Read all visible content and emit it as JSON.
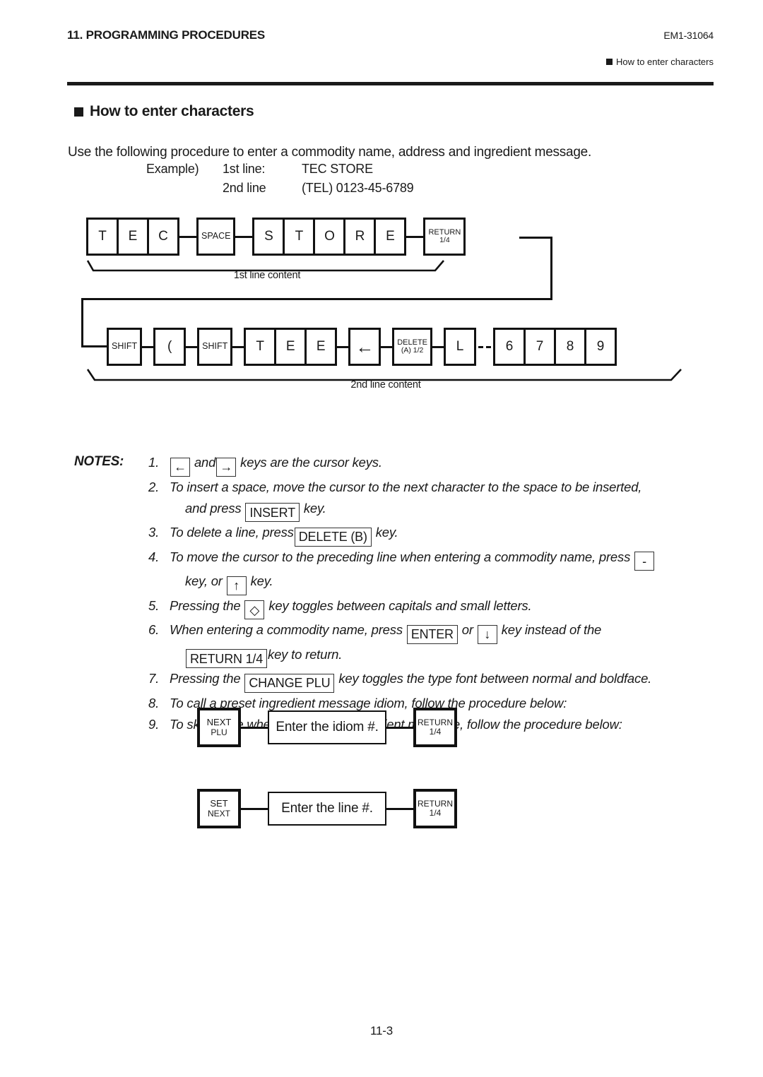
{
  "header": {
    "chapter": "11. PROGRAMMING PROCEDURES",
    "doc_code": "EM1-31064",
    "section": "How to enter characters"
  },
  "title": "How to enter characters",
  "intro": "Use the following procedure to enter a commodity name, address and ingredient message.",
  "example": {
    "label": "Example)",
    "rows": [
      {
        "line": "1st line:",
        "value": "TEC STORE"
      },
      {
        "line": "2nd line",
        "value": "(TEL) 0123-45-6789"
      }
    ]
  },
  "diagram1": {
    "caption": "1st  line content",
    "groups": [
      {
        "keys": [
          {
            "t": "T"
          },
          {
            "t": "E"
          },
          {
            "t": "C"
          }
        ]
      },
      {
        "keys": [
          {
            "t": "SPACE",
            "size": "small"
          }
        ]
      },
      {
        "keys": [
          {
            "t": "S"
          },
          {
            "t": "T"
          },
          {
            "t": "O"
          },
          {
            "t": "R"
          },
          {
            "t": "E"
          }
        ]
      }
    ],
    "return_key": {
      "t": "RETURN",
      "t2": "1/4"
    }
  },
  "diagram2": {
    "caption": "2nd line content",
    "groups": [
      {
        "keys": [
          {
            "t": "SHIFT",
            "size": "small"
          }
        ]
      },
      {
        "keys": [
          {
            "t": "("
          }
        ]
      },
      {
        "keys": [
          {
            "t": "SHIFT",
            "size": "small"
          }
        ]
      },
      {
        "keys": [
          {
            "t": "T"
          },
          {
            "t": "E"
          },
          {
            "t": "E"
          }
        ]
      },
      {
        "keys": [
          {
            "t": "←",
            "size": "arrow"
          }
        ]
      },
      {
        "keys": [
          {
            "t": "DELETE",
            "t2": "(A) 1/2",
            "size": "tiny"
          }
        ]
      },
      {
        "keys": [
          {
            "t": "L"
          }
        ]
      },
      {
        "keys": [
          {
            "t": "6"
          },
          {
            "t": "7"
          },
          {
            "t": "8"
          },
          {
            "t": "9"
          }
        ]
      }
    ]
  },
  "notes": {
    "label": "NOTES:",
    "items": [
      {
        "num": "1.",
        "lines": [
          [
            {
              "type": "key",
              "text": "←"
            },
            {
              "type": "text",
              "text": " and"
            },
            {
              "type": "key",
              "text": "→"
            },
            {
              "type": "text",
              "text": " keys are the cursor keys."
            }
          ]
        ]
      },
      {
        "num": "2.",
        "lines": [
          [
            {
              "type": "text",
              "text": "To insert a space, move the cursor to the next character to the space to be inserted,"
            }
          ],
          [
            {
              "type": "text",
              "text": "and press "
            },
            {
              "type": "key",
              "text": "INSERT"
            },
            {
              "type": "text",
              "text": " key."
            }
          ]
        ]
      },
      {
        "num": "3.",
        "lines": [
          [
            {
              "type": "text",
              "text": "To delete a line, press"
            },
            {
              "type": "key",
              "text": "DELETE (B)"
            },
            {
              "type": "text",
              "text": " key."
            }
          ]
        ]
      },
      {
        "num": "4.",
        "lines": [
          [
            {
              "type": "text",
              "text": "To move the cursor to the preceding line when entering a commodity name, press "
            },
            {
              "type": "key",
              "text": "-"
            }
          ],
          [
            {
              "type": "text",
              "text": "key, or "
            },
            {
              "type": "key",
              "text": "↑"
            },
            {
              "type": "text",
              "text": " key."
            }
          ]
        ]
      },
      {
        "num": "5.",
        "lines": [
          [
            {
              "type": "text",
              "text": "Pressing the "
            },
            {
              "type": "key",
              "text": "◇"
            },
            {
              "type": "text",
              "text": " key toggles between capitals and small letters."
            }
          ]
        ]
      },
      {
        "num": "6.",
        "lines": [
          [
            {
              "type": "text",
              "text": "When entering a commodity name, press "
            },
            {
              "type": "key",
              "text": "ENTER"
            },
            {
              "type": "text",
              "text": " or "
            },
            {
              "type": "key",
              "text": "↓"
            },
            {
              "type": "text",
              "text": " key instead of the"
            }
          ],
          [
            {
              "type": "key",
              "text": "RETURN 1/4"
            },
            {
              "type": "text",
              "text": "key to return."
            }
          ]
        ]
      },
      {
        "num": "7.",
        "lines": [
          [
            {
              "type": "text",
              "text": "Pressing the "
            },
            {
              "type": "key",
              "text": "CHANGE PLU"
            },
            {
              "type": "text",
              "text": " key toggles the type font between normal and boldface."
            }
          ]
        ]
      },
      {
        "num": "8.",
        "lines": [
          [
            {
              "type": "text",
              "text": "To call a preset ingredient message idiom, follow the procedure below:"
            }
          ]
        ]
      },
      {
        "num": "9.",
        "lines": [
          [
            {
              "type": "text",
              "text": "To skip a line when entering an ingredient message, follow the procedure below:"
            }
          ]
        ]
      }
    ]
  },
  "flows": [
    {
      "start": {
        "t": "NEXT",
        "t2": "PLU"
      },
      "box": "Enter the idiom  #.",
      "end": {
        "t": "RETURN",
        "t2": "1/4"
      }
    },
    {
      "start": {
        "t": "SET",
        "t2": "NEXT"
      },
      "box": "Enter the line  #.",
      "end": {
        "t": "RETURN",
        "t2": "1/4"
      }
    }
  ],
  "footer": {
    "page": "11-3"
  }
}
